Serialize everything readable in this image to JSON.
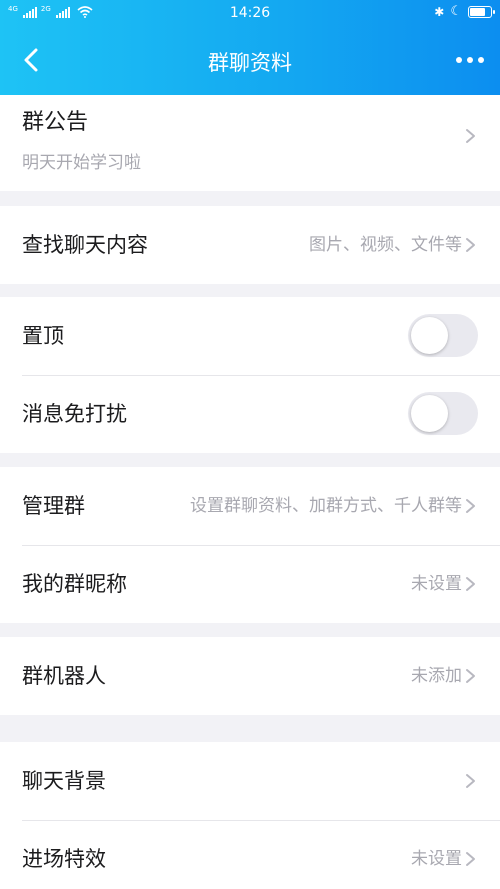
{
  "status_bar": {
    "signal1_label": "4G",
    "signal2_label": "2G",
    "time": "14:26",
    "bluetooth_glyph": "✱",
    "moon_glyph": "☾"
  },
  "nav": {
    "title": "群聊资料",
    "back_icon": "chevron-left-icon",
    "more_icon": "more-dots-icon"
  },
  "announcement": {
    "title": "群公告",
    "content": "明天开始学习啦"
  },
  "search_chat": {
    "label": "查找聊天内容",
    "value": "图片、视频、文件等"
  },
  "pin": {
    "label": "置顶",
    "on": false
  },
  "mute": {
    "label": "消息免打扰",
    "on": false
  },
  "manage": {
    "label": "管理群",
    "value": "设置群聊资料、加群方式、千人群等"
  },
  "nickname": {
    "label": "我的群昵称",
    "value": "未设置"
  },
  "robot": {
    "label": "群机器人",
    "value": "未添加"
  },
  "background": {
    "label": "聊天背景",
    "value": ""
  },
  "entry_effect": {
    "label": "进场特效",
    "value": "未设置"
  },
  "colors": {
    "header_start": "#1ec3f5",
    "header_end": "#0c8ef0",
    "page_bg": "#f2f2f6",
    "secondary_text": "#a8a8b0",
    "toggle_off": "#e9e9ef"
  }
}
